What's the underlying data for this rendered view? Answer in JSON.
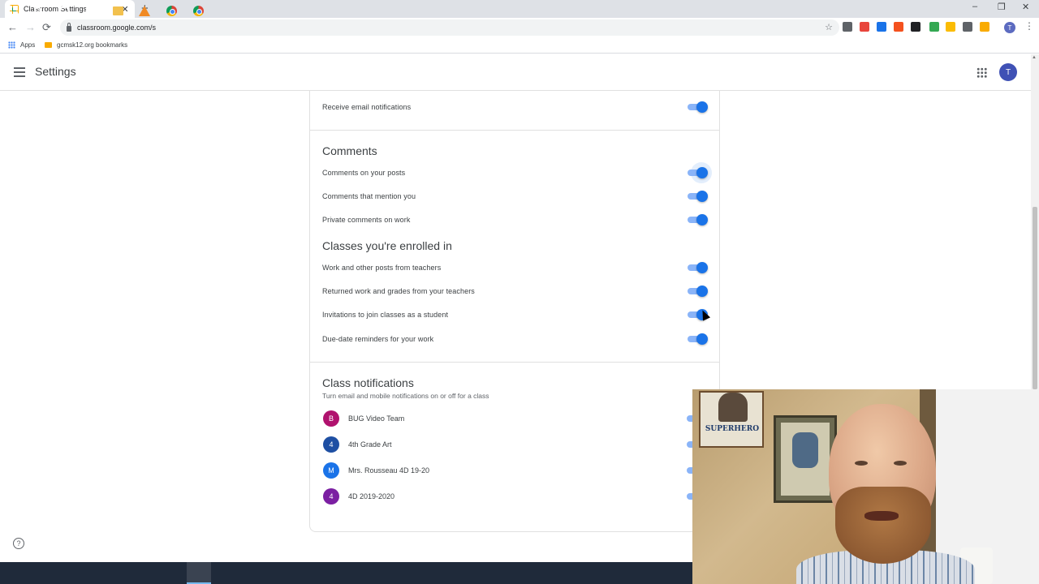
{
  "browser": {
    "tab_title": "Classroom Settings",
    "tab_close": "✕",
    "new_tab": "+",
    "url": "classroom.google.com/s",
    "back": "←",
    "forward": "→",
    "reload": "⟳",
    "star": "☆",
    "menu": "⋮",
    "profile_initial": "T",
    "window_controls": {
      "minimize": "–",
      "restore": "❐",
      "close": "✕"
    },
    "bookmarks": {
      "apps_label": "Apps",
      "folder_label": "gcmsk12.org bookmarks"
    },
    "extension_colors": [
      "#5f6368",
      "#e8453c",
      "#1a73e8",
      "#f4511e",
      "#202124",
      "#34a853",
      "#fbbc04",
      "#5f6368",
      "#f9ab00"
    ]
  },
  "app": {
    "title": "Settings",
    "avatar_initial": "T"
  },
  "settings": {
    "email_row": {
      "label": "Receive email notifications",
      "on": true
    },
    "comments": {
      "title": "Comments",
      "items": [
        {
          "label": "Comments on your posts",
          "on": true
        },
        {
          "label": "Comments that mention you",
          "on": true
        },
        {
          "label": "Private comments on work",
          "on": true
        }
      ]
    },
    "enrolled": {
      "title": "Classes you're enrolled in",
      "items": [
        {
          "label": "Work and other posts from teachers",
          "on": true
        },
        {
          "label": "Returned work and grades from your teachers",
          "on": true
        },
        {
          "label": "Invitations to join classes as a student",
          "on": true
        },
        {
          "label": "Due-date reminders for your work",
          "on": true
        }
      ]
    },
    "class_notifications": {
      "title": "Class notifications",
      "subtitle": "Turn email and mobile notifications on or off for a class",
      "classes": [
        {
          "initial": "B",
          "name": "BUG Video Team",
          "color": "#b0126e"
        },
        {
          "initial": "4",
          "name": "4th Grade Art",
          "color": "#1e4fa3"
        },
        {
          "initial": "M",
          "name": "Mrs. Rousseau 4D 19-20",
          "color": "#1a73e8"
        },
        {
          "initial": "4",
          "name": "4D 2019-2020",
          "color": "#7b1fa2"
        }
      ]
    }
  },
  "help_icon": "?",
  "webcam": {
    "poster_text": "SUPERHERO"
  }
}
